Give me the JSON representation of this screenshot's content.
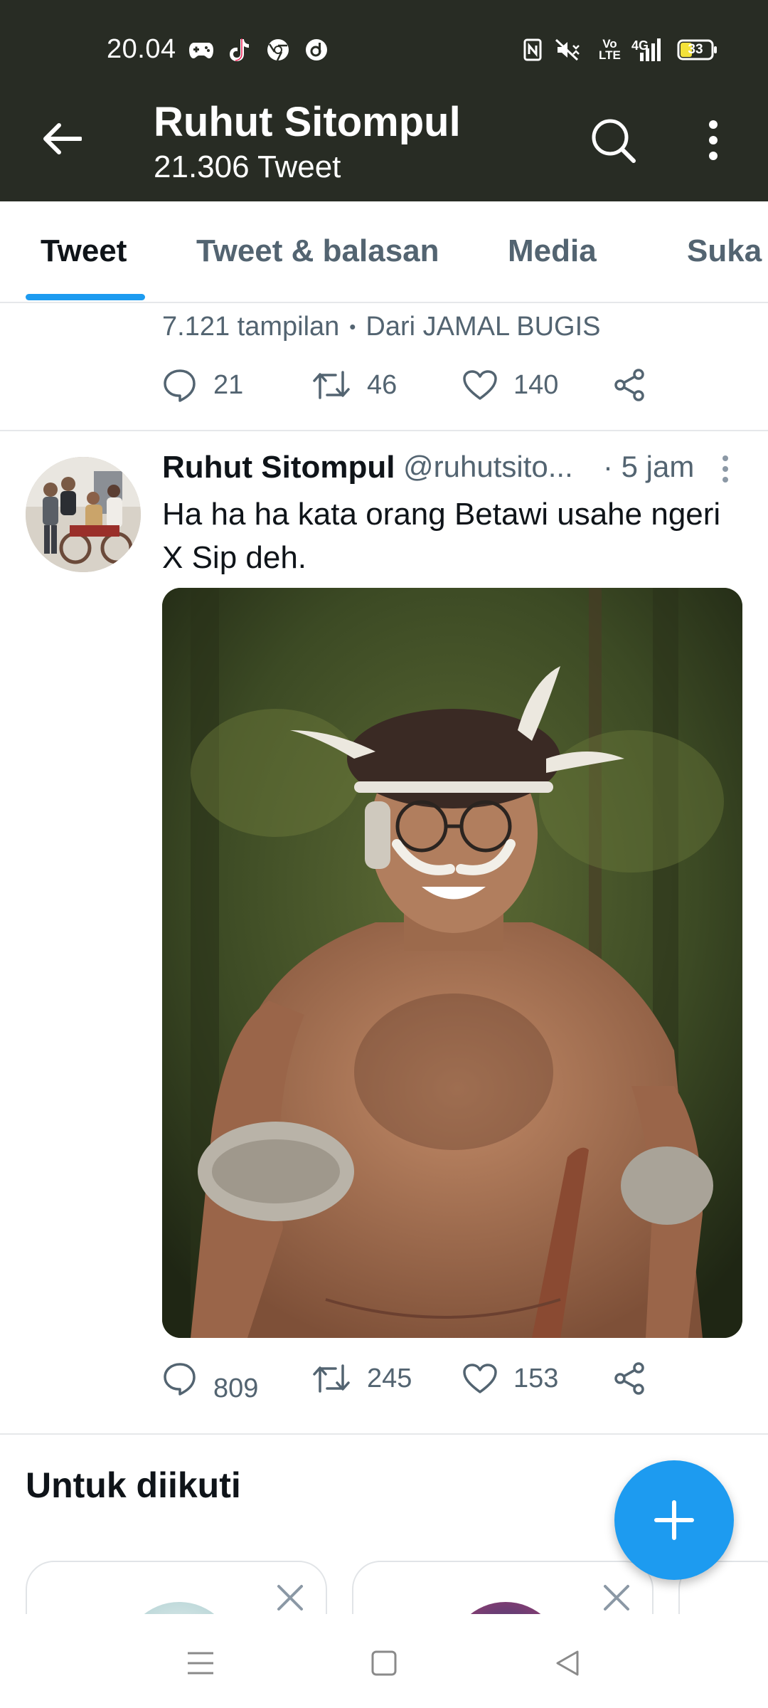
{
  "status_bar": {
    "time": "20.04",
    "left_icons": [
      "gamepad-icon",
      "tiktok-icon",
      "chrome-icon",
      "dana-icon"
    ],
    "right_icons": [
      "nfc-icon",
      "mute-icon",
      "volte-icon",
      "signal-4g-icon"
    ],
    "network_label": "4G",
    "volte_label": "Vo LTE",
    "battery": "33"
  },
  "header": {
    "title": "Ruhut Sitompul",
    "subtitle": "21.306 Tweet"
  },
  "tabs": [
    {
      "label": "Tweet",
      "active": true
    },
    {
      "label": "Tweet & balasan",
      "active": false
    },
    {
      "label": "Media",
      "active": false
    },
    {
      "label": "Suka",
      "active": false
    }
  ],
  "previous_tweet": {
    "views": "7.121 tampilan",
    "separator": "•",
    "source": "Dari JAMAL BUGIS",
    "replies": "21",
    "retweets": "46",
    "likes": "140"
  },
  "tweet": {
    "name": "Ruhut Sitompul",
    "handle": "@ruhutsito...",
    "time": "· 5 jam",
    "text": "Ha ha ha kata orang Betawi usahe ngeri X Sip deh.",
    "replies": "809",
    "retweets": "245",
    "likes": "153"
  },
  "who_to_follow": {
    "title": "Untuk diikuti"
  },
  "colors": {
    "header_bg": "#282c24",
    "accent": "#1d9bf0",
    "secondary_text": "#536471"
  }
}
